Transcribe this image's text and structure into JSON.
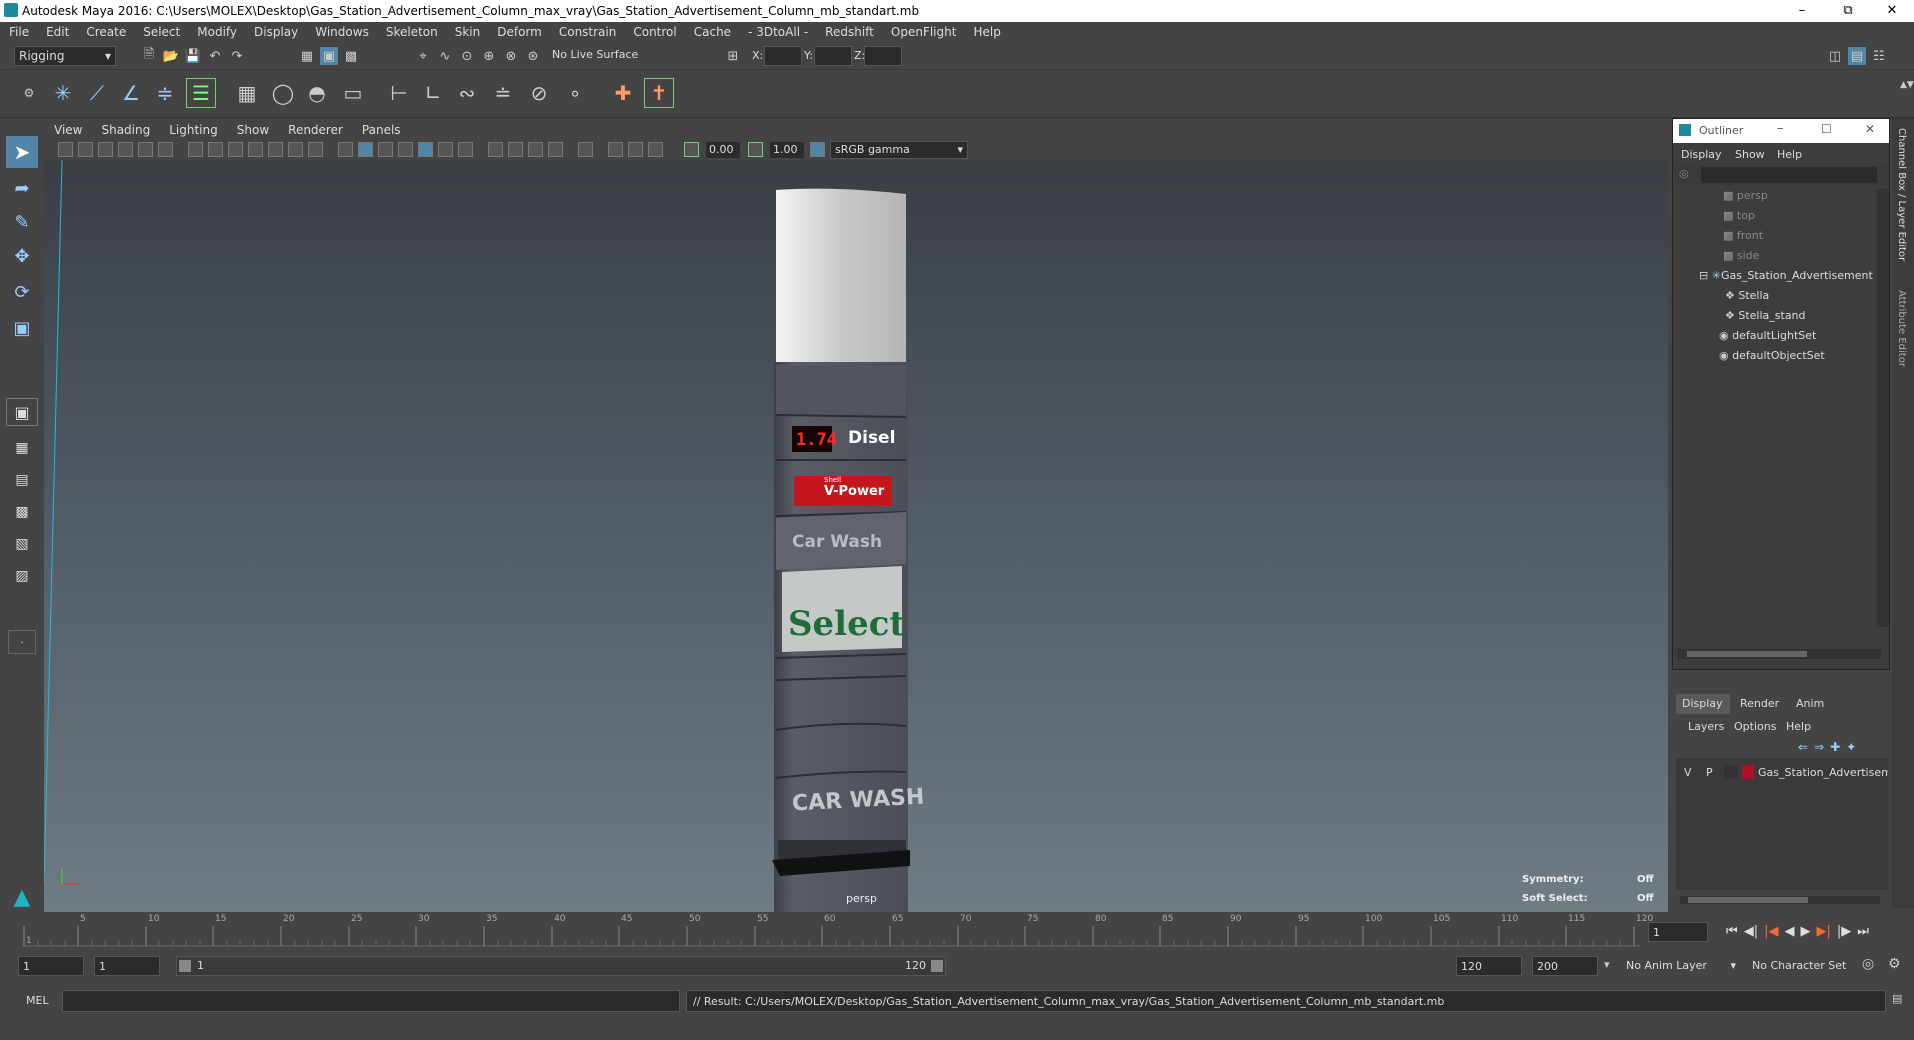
{
  "window": {
    "title": "Autodesk Maya 2016: C:\\Users\\MOLEX\\Desktop\\Gas_Station_Advertisement_Column_max_vray\\Gas_Station_Advertisement_Column_mb_standart.mb"
  },
  "menubar": [
    "File",
    "Edit",
    "Create",
    "Select",
    "Modify",
    "Display",
    "Windows",
    "Skeleton",
    "Skin",
    "Deform",
    "Constrain",
    "Control",
    "Cache",
    "- 3DtoAll -",
    "Redshift",
    "OpenFlight",
    "Help"
  ],
  "toolbar": {
    "mode": "Rigging",
    "live_surface": "No Live Surface",
    "x_label": "X:",
    "y_label": "Y:",
    "z_label": "Z:"
  },
  "panel_menu": [
    "View",
    "Shading",
    "Lighting",
    "Show",
    "Renderer",
    "Panels"
  ],
  "panel_bar": {
    "exposure": "0.00",
    "gamma": "1.00",
    "colorspace": "sRGB gamma"
  },
  "viewport": {
    "camera": "persp",
    "symmetry_label": "Symmetry:",
    "symmetry_value": "Off",
    "soft_select_label": "Soft Select:",
    "soft_select_value": "Off",
    "column": {
      "price": "1.74",
      "fuel": "Disel",
      "brand_small": "Shell",
      "brand": "V-Power",
      "carwash1": "Car Wash",
      "select": "Select",
      "carwash2": "CAR WASH"
    }
  },
  "outliner": {
    "title": "Outliner",
    "menu": [
      "Display",
      "Show",
      "Help"
    ],
    "items": [
      {
        "label": "persp",
        "dim": true
      },
      {
        "label": "top",
        "dim": true
      },
      {
        "label": "front",
        "dim": true
      },
      {
        "label": "side",
        "dim": true
      },
      {
        "label": "Gas_Station_Advertisement",
        "dim": false
      },
      {
        "label": "Stella",
        "dim": false
      },
      {
        "label": "Stella_stand",
        "dim": false
      },
      {
        "label": "defaultLightSet",
        "dim": false
      },
      {
        "label": "defaultObjectSet",
        "dim": false
      }
    ]
  },
  "layer_panel": {
    "tabs": [
      "Display",
      "Render",
      "Anim"
    ],
    "menu": [
      "Layers",
      "Options",
      "Help"
    ],
    "layer": {
      "v": "V",
      "p": "P",
      "name": "Gas_Station_Advertisement",
      "color": "#b0102a"
    }
  },
  "side_tabs": [
    "Channel Box / Layer Editor",
    "Attribute Editor"
  ],
  "timeline": {
    "ticks": [
      "1",
      "5",
      "10",
      "15",
      "20",
      "25",
      "30",
      "35",
      "40",
      "45",
      "50",
      "55",
      "60",
      "65",
      "70",
      "75",
      "80",
      "85",
      "90",
      "95",
      "100",
      "105",
      "110",
      "115",
      "120"
    ],
    "current": "1"
  },
  "range": {
    "start": "1",
    "playback_start": "1",
    "slider_start": "1",
    "slider_end": "120",
    "playback_end": "120",
    "end": "200",
    "anim_layer": "No Anim Layer",
    "char_set": "No Character Set"
  },
  "cmdline": {
    "lang": "MEL",
    "result": "// Result: C:/Users/MOLEX/Desktop/Gas_Station_Advertisement_Column_max_vray/Gas_Station_Advertisement_Column_mb_standart.mb"
  },
  "colors": {
    "accent": "#5285a6",
    "ui_bg": "#444444",
    "viewport_top": "#3a3f44",
    "viewport_bottom": "#6f7c83"
  }
}
